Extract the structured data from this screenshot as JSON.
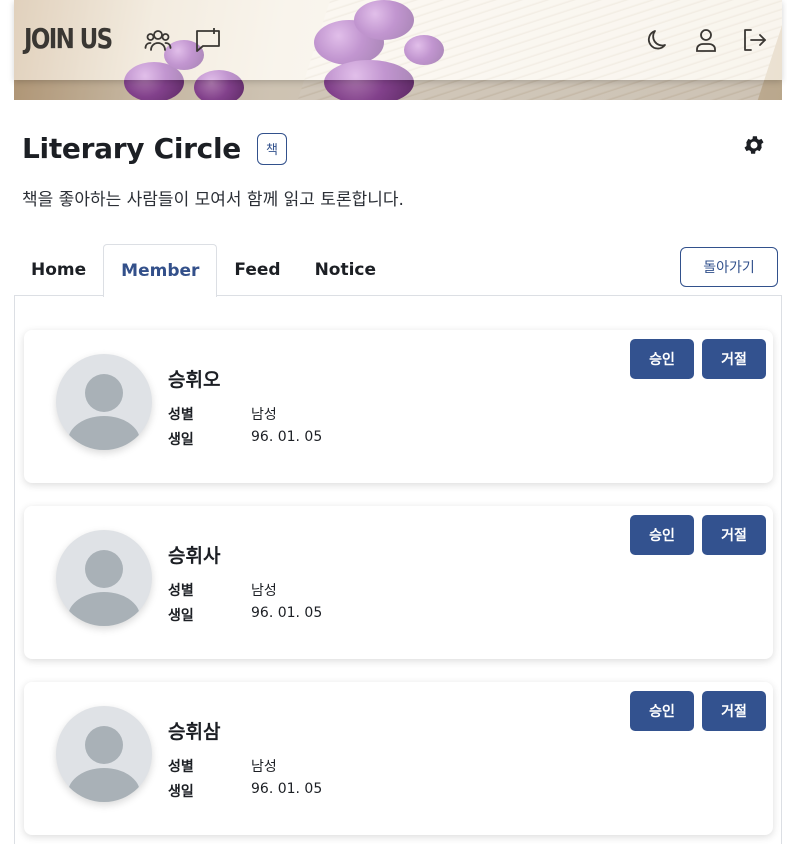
{
  "header": {
    "logo_text": "JOIN US",
    "icons": [
      "group-icon",
      "board-icon",
      "moon-icon",
      "user-icon",
      "logout-icon"
    ]
  },
  "group": {
    "title": "Literary Circle",
    "category": "책",
    "description": "책을 좋아하는 사람들이 모여서 함께 읽고 토론합니다."
  },
  "tabs": [
    {
      "label": "Home",
      "active": false
    },
    {
      "label": "Member",
      "active": true
    },
    {
      "label": "Feed",
      "active": false
    },
    {
      "label": "Notice",
      "active": false
    }
  ],
  "back_button": "돌아가기",
  "labels": {
    "gender": "성별",
    "birth": "생일",
    "approve": "승인",
    "reject": "거절"
  },
  "members": [
    {
      "name": "승휘오",
      "gender": "남성",
      "birth": "96. 01. 05"
    },
    {
      "name": "승휘사",
      "gender": "남성",
      "birth": "96. 01. 05"
    },
    {
      "name": "승휘삼",
      "gender": "남성",
      "birth": "96. 01. 05"
    }
  ],
  "colors": {
    "primary": "#33528f",
    "text": "#1c1f24",
    "border": "#dcdfe4"
  }
}
